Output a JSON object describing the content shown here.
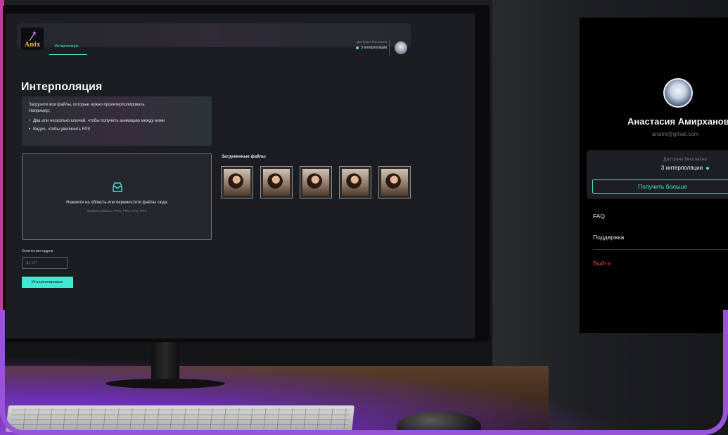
{
  "app": {
    "logo_text": "Anix",
    "nav_tab": "Интерполяция",
    "credits_label": "Доступно бесплатно",
    "credits_value": "3 интерполяции"
  },
  "main": {
    "title": "Интерполяция",
    "info": {
      "line1": "Загрузите все файлы, которые нужно проинтерполировать.",
      "line2": "Например:",
      "bullets": [
        "Два или несколько ключей, чтобы получить анимацию между ними",
        "Видео, чтобы увеличить FPS"
      ]
    },
    "dropzone": {
      "text": "Нажмите на область или переместите файлы сюда",
      "formats": "Форматы файла: JPEG, PNG, SVG, MP4"
    },
    "frames_label": "Количество кадров",
    "frames_placeholder": "До 127",
    "interpolate_button": "Интерполировать",
    "uploaded_label": "Загруженные файлы",
    "uploaded_count": 5
  },
  "profile": {
    "name": "Анастасия Амирханова",
    "email": "anami@gmail.com",
    "credits_label": "Доступно бесплатно",
    "credits_value": "3 интерполяции",
    "more_button": "Получить больше",
    "menu": {
      "faq": "FAQ",
      "support": "Поддержка",
      "logout": "Выйти"
    }
  },
  "colors": {
    "accent": "#3ee8d2",
    "danger": "#e0413a",
    "frame": "#9a52d9",
    "magenta_edge": "#c13ea1"
  }
}
